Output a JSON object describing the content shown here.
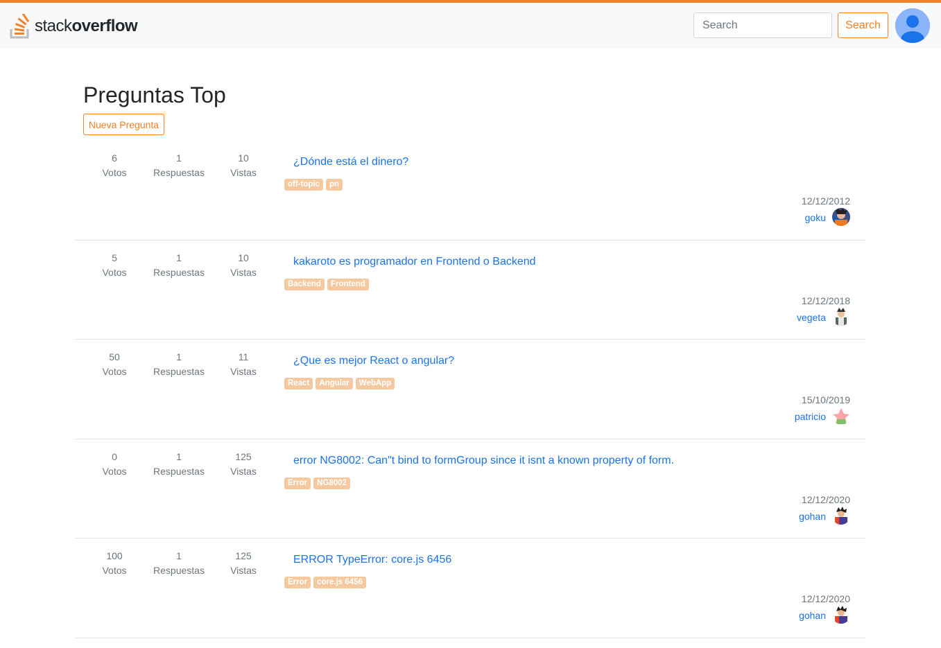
{
  "header": {
    "logo_text_light": "stack",
    "logo_text_bold": "overflow",
    "search_placeholder": "Search",
    "search_button": "Search"
  },
  "main": {
    "title": "Preguntas Top",
    "new_question_button": "Nueva Pregunta",
    "questions": [
      {
        "votes": "6",
        "votes_label": "Votos",
        "answers": "1",
        "answers_label": "Respuestas",
        "views": "10",
        "views_label": "Vistas",
        "title": "¿Dónde está el dinero?",
        "tags": [
          "off-topic",
          "pn"
        ],
        "date": "12/12/2012",
        "author": "goku"
      },
      {
        "votes": "5",
        "votes_label": "Votos",
        "answers": "1",
        "answers_label": "Respuestas",
        "views": "10",
        "views_label": "Vistas",
        "title": "kakaroto es programador en Frontend o Backend",
        "tags": [
          "Backend",
          "Frontend"
        ],
        "date": "12/12/2018",
        "author": "vegeta"
      },
      {
        "votes": "50",
        "votes_label": "Votos",
        "answers": "1",
        "answers_label": "Respuestas",
        "views": "11",
        "views_label": "Vistas",
        "title": "¿Que es mejor React o angular?",
        "tags": [
          "React",
          "Angular",
          "WebApp"
        ],
        "date": "15/10/2019",
        "author": "patricio"
      },
      {
        "votes": "0",
        "votes_label": "Votos",
        "answers": "1",
        "answers_label": "Respuestas",
        "views": "125",
        "views_label": "Vistas",
        "title": "error NG8002: Can\"t bind to formGroup since it isnt a known property of form.",
        "tags": [
          "Error",
          "NG8002"
        ],
        "date": "12/12/2020",
        "author": "gohan"
      },
      {
        "votes": "100",
        "votes_label": "Votos",
        "answers": "1",
        "answers_label": "Respuestas",
        "views": "125",
        "views_label": "Vistas",
        "title": "ERROR TypeError: core.js 6456",
        "tags": [
          "Error",
          "core.js 6456"
        ],
        "date": "12/12/2020",
        "author": "gohan"
      }
    ]
  },
  "colors": {
    "accent": "#f48024",
    "link": "#1a73e8",
    "tag_bg": "#f5c9a0",
    "muted": "#6c757d"
  }
}
